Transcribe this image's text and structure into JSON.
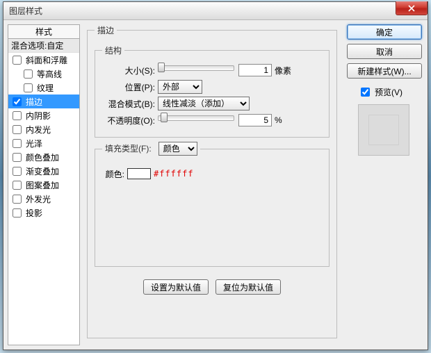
{
  "window": {
    "title": "图层样式"
  },
  "styles_panel": {
    "header": "样式",
    "blend_options": "混合选项:自定",
    "items": [
      {
        "label": "斜面和浮雕",
        "checked": false,
        "indent": false
      },
      {
        "label": "等高线",
        "checked": false,
        "indent": true
      },
      {
        "label": "纹理",
        "checked": false,
        "indent": true
      },
      {
        "label": "描边",
        "checked": true,
        "indent": false,
        "selected": true
      },
      {
        "label": "内阴影",
        "checked": false,
        "indent": false
      },
      {
        "label": "内发光",
        "checked": false,
        "indent": false
      },
      {
        "label": "光泽",
        "checked": false,
        "indent": false
      },
      {
        "label": "颜色叠加",
        "checked": false,
        "indent": false
      },
      {
        "label": "渐变叠加",
        "checked": false,
        "indent": false
      },
      {
        "label": "图案叠加",
        "checked": false,
        "indent": false
      },
      {
        "label": "外发光",
        "checked": false,
        "indent": false
      },
      {
        "label": "投影",
        "checked": false,
        "indent": false
      }
    ]
  },
  "stroke": {
    "group_label": "描边",
    "struct_label": "结构",
    "size_label": "大小(S):",
    "size_value": "1",
    "size_unit": "像素",
    "position_label": "位置(P):",
    "position_value": "外部",
    "blendmode_label": "混合模式(B):",
    "blendmode_value": "线性减淡（添加）",
    "opacity_label": "不透明度(O):",
    "opacity_value": "5",
    "opacity_unit": "%",
    "fill_group_label": "填充类型(F):",
    "fill_type_value": "颜色",
    "color_label": "颜色:",
    "color_hex": "#ffffff",
    "set_default": "设置为默认值",
    "reset_default": "复位为默认值"
  },
  "right": {
    "ok": "确定",
    "cancel": "取消",
    "new_style": "新建样式(W)...",
    "preview_label": "预览(V)",
    "preview_checked": true
  }
}
